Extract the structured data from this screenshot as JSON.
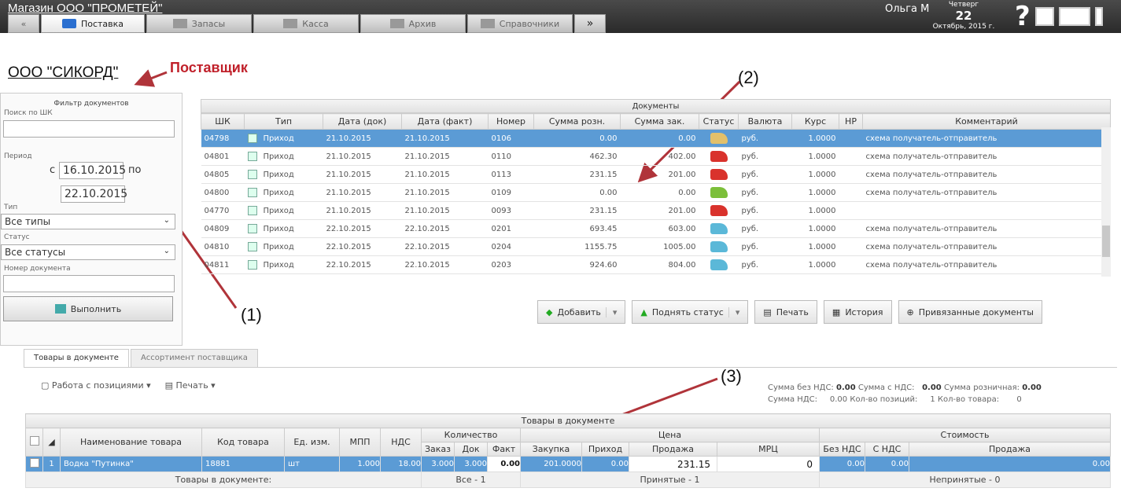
{
  "app": {
    "title": "Магазин ООО \"ПРОМЕТЕЙ\""
  },
  "tabs": [
    {
      "label": "Поставка"
    },
    {
      "label": "Запасы"
    },
    {
      "label": "Касса"
    },
    {
      "label": "Архив"
    },
    {
      "label": "Справочники"
    }
  ],
  "user": {
    "name": "Ольга М",
    "weekday": "Четверг",
    "day": "22",
    "month_year": "Октябрь, 2015 г."
  },
  "supplier": "ООО \"СИКОРД\"",
  "annotations": {
    "supplier_label": "Поставщик",
    "n1": "(1)",
    "n2": "(2)",
    "n3": "(3)"
  },
  "filter": {
    "title": "Фильтр документов",
    "search_label": "Поиск по ШК",
    "period_label": "Период",
    "from_prefix": "с",
    "date_from": "16.10.2015",
    "to_prefix": "по",
    "date_to": "22.10.2015",
    "type_label": "Тип",
    "type_value": "Все типы",
    "status_label": "Статус",
    "status_value": "Все статусы",
    "docnum_label": "Номер документа",
    "execute": "Выполнить"
  },
  "docs": {
    "title": "Документы",
    "columns": [
      "ШК",
      "Тип",
      "Дата (док)",
      "Дата (факт)",
      "Номер",
      "Сумма розн.",
      "Сумма зак.",
      "Статус",
      "Валюта",
      "Курс",
      "НР",
      "Комментарий"
    ],
    "rows": [
      {
        "shk": "04798",
        "type": "Приход",
        "d1": "21.10.2015",
        "d2": "21.10.2015",
        "num": "0106",
        "sr": "0.00",
        "sz": "0.00",
        "status": "#e2c06a",
        "cur": "руб.",
        "rate": "1.0000",
        "comment": "схема получатель-отправитель"
      },
      {
        "shk": "04801",
        "type": "Приход",
        "d1": "21.10.2015",
        "d2": "21.10.2015",
        "num": "0110",
        "sr": "462.30",
        "sz": "402.00",
        "status": "#d9322c",
        "cur": "руб.",
        "rate": "1.0000",
        "comment": "схема получатель-отправитель"
      },
      {
        "shk": "04805",
        "type": "Приход",
        "d1": "21.10.2015",
        "d2": "21.10.2015",
        "num": "0113",
        "sr": "231.15",
        "sz": "201.00",
        "status": "#d9322c",
        "cur": "руб.",
        "rate": "1.0000",
        "comment": "схема получатель-отправитель"
      },
      {
        "shk": "04800",
        "type": "Приход",
        "d1": "21.10.2015",
        "d2": "21.10.2015",
        "num": "0109",
        "sr": "0.00",
        "sz": "0.00",
        "status": "#7cbf3a",
        "cur": "руб.",
        "rate": "1.0000",
        "comment": "схема получатель-отправитель"
      },
      {
        "shk": "04770",
        "type": "Приход",
        "d1": "21.10.2015",
        "d2": "21.10.2015",
        "num": "0093",
        "sr": "231.15",
        "sz": "201.00",
        "status": "#d9322c",
        "cur": "руб.",
        "rate": "1.0000",
        "comment": ""
      },
      {
        "shk": "04809",
        "type": "Приход",
        "d1": "22.10.2015",
        "d2": "22.10.2015",
        "num": "0201",
        "sr": "693.45",
        "sz": "603.00",
        "status": "#5bb8d8",
        "cur": "руб.",
        "rate": "1.0000",
        "comment": "схема получатель-отправитель"
      },
      {
        "shk": "04810",
        "type": "Приход",
        "d1": "22.10.2015",
        "d2": "22.10.2015",
        "num": "0204",
        "sr": "1155.75",
        "sz": "1005.00",
        "status": "#5bb8d8",
        "cur": "руб.",
        "rate": "1.0000",
        "comment": "схема получатель-отправитель"
      },
      {
        "shk": "04811",
        "type": "Приход",
        "d1": "22.10.2015",
        "d2": "22.10.2015",
        "num": "0203",
        "sr": "924.60",
        "sz": "804.00",
        "status": "#5bb8d8",
        "cur": "руб.",
        "rate": "1.0000",
        "comment": "схема получатель-отправитель"
      }
    ],
    "toolbar": {
      "add": "Добавить",
      "raise": "Поднять статус",
      "print": "Печать",
      "history": "История",
      "linked": "Привязанные документы"
    }
  },
  "bottom": {
    "tabs": [
      "Товары в документе",
      "Ассортимент поставщика"
    ],
    "work": "Работа с позициями",
    "print": "Печать",
    "summary": {
      "l1": "Сумма без НДС:",
      "v1": "0.00",
      "l2": "Сумма с НДС:",
      "v2": "0.00",
      "l3": "Сумма розничная:",
      "v3": "0.00",
      "l4": "Сумма НДС:",
      "v4": "0.00",
      "l5": "Кол-во позиций:",
      "v5": "1",
      "l6": "Кол-во товара:",
      "v6": "0"
    },
    "grid": {
      "title": "Товары в документе",
      "h_name": "Наименование товара",
      "h_code": "Код товара",
      "h_unit": "Ед. изм.",
      "h_mpp": "МПП",
      "h_vat": "НДС",
      "g_qty": "Количество",
      "g_price": "Цена",
      "g_cost": "Стоимость",
      "h_order": "Заказ",
      "h_doc": "Док",
      "h_fact": "Факт",
      "h_buy": "Закупка",
      "h_in": "Приход",
      "h_sell": "Продажа",
      "h_mrc": "МРЦ",
      "h_novat": "Без НДС",
      "h_withvat": "С НДС",
      "h_sale": "Продажа",
      "row": {
        "n": "1",
        "name": "Водка \"Путинка\"",
        "code": "18881",
        "unit": "шт",
        "mpp": "1.000",
        "vat": "18.00",
        "order": "3.000",
        "doc": "3.000",
        "fact": "0.00",
        "buy": "201.0000",
        "in": "0.00",
        "sell": "231.15",
        "mrc": "0",
        "novat": "0.00",
        "withvat": "0.00",
        "sale": "0.00"
      },
      "foot": {
        "docs": "Товары в документе:",
        "all": "Все - 1",
        "accepted": "Принятые - 1",
        "rejected": "Непринятые - 0"
      }
    }
  }
}
